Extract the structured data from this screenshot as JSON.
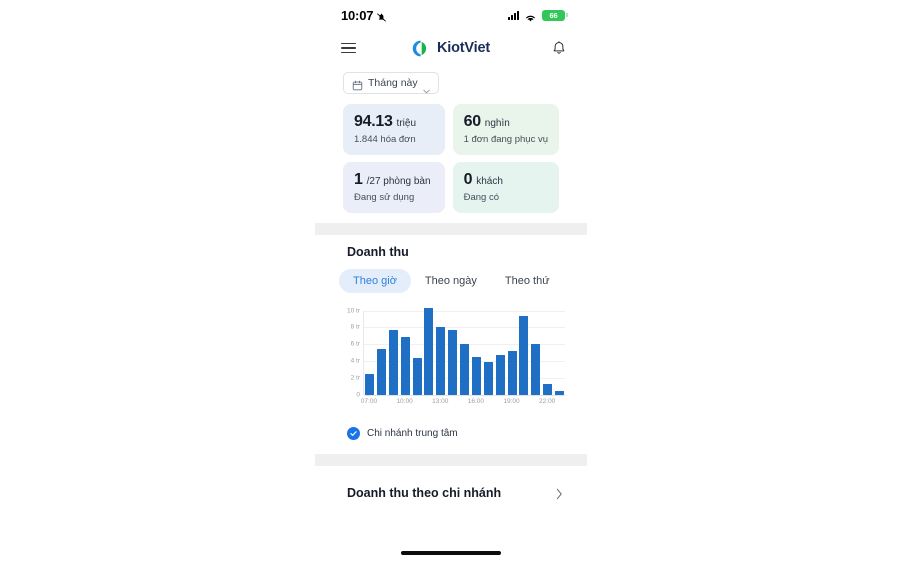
{
  "status_bar": {
    "time": "10:07",
    "mute_icon": "bell-mute-icon",
    "signal_icon": "cellular-signal-icon",
    "wifi_icon": "wifi-icon",
    "battery_level": "66"
  },
  "header": {
    "menu_icon": "hamburger-menu-icon",
    "logo_icon": "kiotviet-logo-icon",
    "brand": "KiotViet",
    "notification_icon": "bell-icon"
  },
  "filter": {
    "calendar_icon": "calendar-icon",
    "label": "Tháng này",
    "chevron_icon": "chevron-down-icon"
  },
  "stats": [
    {
      "value": "94.13",
      "unit": "triệu",
      "sub": "1.844 hóa đơn",
      "theme": "c-blue",
      "name": "stat-card-revenue"
    },
    {
      "value": "60",
      "unit": "nghìn",
      "sub": "1 đơn đang phục vụ",
      "theme": "c-green",
      "name": "stat-card-serving"
    },
    {
      "value": "1",
      "unit": "/27 phòng bàn",
      "sub": "Đang sử dụng",
      "theme": "c-violet",
      "name": "stat-card-tables"
    },
    {
      "value": "0",
      "unit": "khách",
      "sub": "Đang có",
      "theme": "c-mint",
      "name": "stat-card-guests"
    }
  ],
  "revenue": {
    "title": "Doanh thu",
    "tabs": [
      {
        "label": "Theo giờ",
        "active": true
      },
      {
        "label": "Theo ngày",
        "active": false
      },
      {
        "label": "Theo thứ",
        "active": false
      }
    ],
    "legend": {
      "checked": true,
      "check_icon": "check-icon",
      "label": "Chi nhánh trung tâm"
    }
  },
  "branch_section": {
    "label": "Doanh thu theo chi nhánh",
    "chevron_icon": "chevron-right-icon"
  },
  "colors": {
    "bar": "#1f6fc4",
    "accent": "#2f7fe0",
    "tab_active_bg": "#e4eefb",
    "checkbox": "#1a73e8",
    "battery": "#31c859",
    "brand_text": "#1a2e5a"
  },
  "chart_data": {
    "type": "bar",
    "title": "Doanh thu",
    "xlabel": "",
    "ylabel": "",
    "unit": "tr",
    "ylim": [
      0,
      10
    ],
    "grid": true,
    "legend_position": "below",
    "y_ticks": [
      "0",
      "2 tr",
      "4 tr",
      "6 tr",
      "8 tr",
      "10 tr"
    ],
    "y_tick_values": [
      0,
      2,
      4,
      6,
      8,
      10
    ],
    "x_tick_labels": [
      "07:00",
      "10:00",
      "13:00",
      "16:00",
      "19:00",
      "22:00"
    ],
    "categories": [
      "07:00",
      "08:00",
      "09:00",
      "10:00",
      "11:00",
      "12:00",
      "13:00",
      "14:00",
      "15:00",
      "16:00",
      "17:00",
      "18:00",
      "19:00",
      "20:00",
      "21:00",
      "22:00",
      "23:00"
    ],
    "series": [
      {
        "name": "Chi nhánh trung tâm",
        "values": [
          2.4,
          5.4,
          7.7,
          6.9,
          4.4,
          10.3,
          8.0,
          7.7,
          6.0,
          4.5,
          3.9,
          4.7,
          5.2,
          9.3,
          6.0,
          1.2,
          0.4
        ]
      }
    ]
  }
}
